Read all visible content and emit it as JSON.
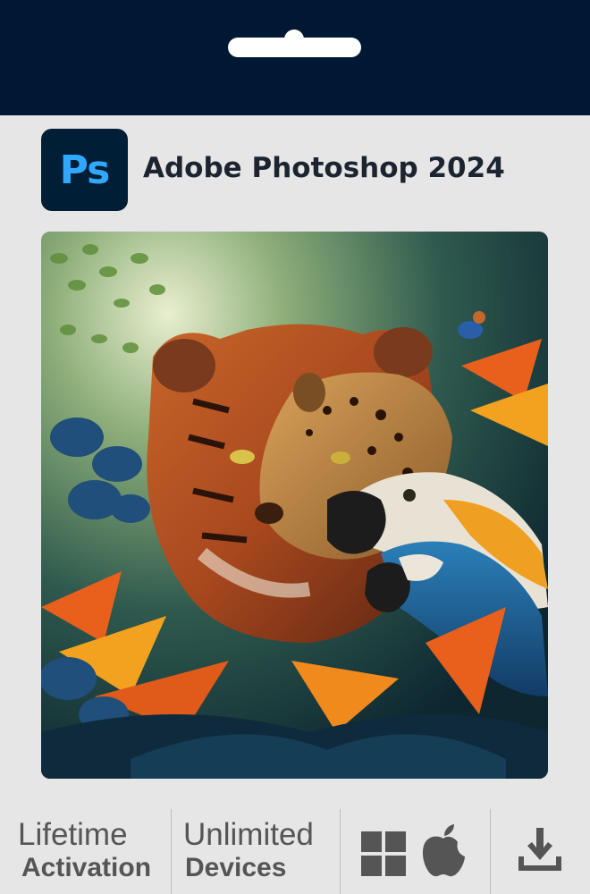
{
  "product": {
    "logo_text": "Ps",
    "title": "Adobe Photoshop 2024"
  },
  "features": [
    {
      "line1": "Lifetime",
      "line2": "Activation"
    },
    {
      "line1": "Unlimited",
      "line2": "Devices"
    }
  ],
  "platform_icons": [
    "windows-icon",
    "apple-icon"
  ],
  "download_icon": "download-icon",
  "colors": {
    "header_bg": "#001833",
    "logo_bg": "#001e36",
    "logo_text": "#31a8ff",
    "feature_text": "#555555"
  }
}
